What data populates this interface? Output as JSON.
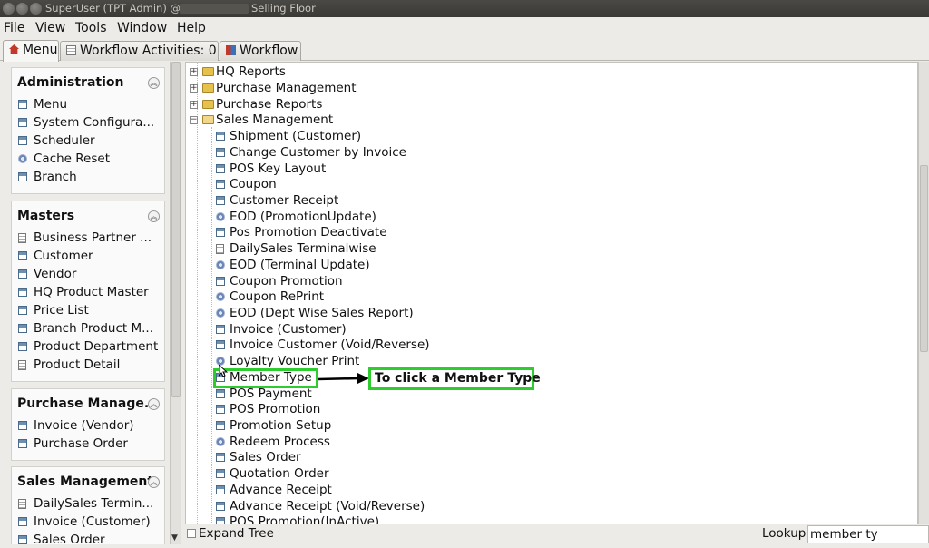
{
  "window": {
    "title_part1": "SuperUser (TPT Admin) @",
    "title_part2": "Selling Floor"
  },
  "menubar": [
    "File",
    "View",
    "Tools",
    "Window",
    "Help"
  ],
  "tabs": [
    {
      "label": "Menu",
      "icon": "home-icon"
    },
    {
      "label": "Workflow Activities: 0",
      "icon": "document-icon"
    },
    {
      "label": "Workflow",
      "icon": "workflow-icon"
    }
  ],
  "groups": [
    {
      "title": "Administration",
      "items": [
        {
          "label": "Menu",
          "icon": "window-icon"
        },
        {
          "label": "System Configura...",
          "icon": "window-icon"
        },
        {
          "label": "Scheduler",
          "icon": "window-icon"
        },
        {
          "label": "Cache Reset",
          "icon": "gear-icon"
        },
        {
          "label": "Branch",
          "icon": "window-icon"
        }
      ]
    },
    {
      "title": "Masters",
      "items": [
        {
          "label": "Business Partner ...",
          "icon": "document-icon"
        },
        {
          "label": "Customer",
          "icon": "window-icon"
        },
        {
          "label": "Vendor",
          "icon": "window-icon"
        },
        {
          "label": "HQ Product Master",
          "icon": "window-icon"
        },
        {
          "label": "Price List",
          "icon": "window-icon"
        },
        {
          "label": "Branch Product M...",
          "icon": "window-icon"
        },
        {
          "label": "Product Department",
          "icon": "window-icon"
        },
        {
          "label": "Product Detail",
          "icon": "document-icon"
        }
      ]
    },
    {
      "title": "Purchase Manage...",
      "items": [
        {
          "label": "Invoice (Vendor)",
          "icon": "window-icon"
        },
        {
          "label": "Purchase Order",
          "icon": "window-icon"
        }
      ]
    },
    {
      "title": "Sales Management",
      "items": [
        {
          "label": "DailySales Termin...",
          "icon": "document-icon"
        },
        {
          "label": "Invoice (Customer)",
          "icon": "window-icon"
        },
        {
          "label": "Sales Order",
          "icon": "window-icon"
        }
      ]
    }
  ],
  "tree": {
    "folders": [
      {
        "label": "HQ Reports",
        "expanded": false
      },
      {
        "label": "Purchase Management",
        "expanded": false
      },
      {
        "label": "Purchase Reports",
        "expanded": false
      },
      {
        "label": "Sales Management",
        "expanded": true
      }
    ],
    "children": [
      {
        "label": "Shipment (Customer)",
        "icon": "window-icon"
      },
      {
        "label": "Change Customer by Invoice",
        "icon": "window-icon"
      },
      {
        "label": "POS Key Layout",
        "icon": "window-icon"
      },
      {
        "label": "Coupon",
        "icon": "window-icon"
      },
      {
        "label": "Customer Receipt",
        "icon": "window-icon"
      },
      {
        "label": "EOD (PromotionUpdate)",
        "icon": "gear-icon"
      },
      {
        "label": "Pos Promotion Deactivate",
        "icon": "window-icon"
      },
      {
        "label": "DailySales Terminalwise",
        "icon": "document-icon"
      },
      {
        "label": "EOD (Terminal Update)",
        "icon": "gear-icon"
      },
      {
        "label": "Coupon Promotion",
        "icon": "window-icon"
      },
      {
        "label": "Coupon RePrint",
        "icon": "gear-icon"
      },
      {
        "label": "EOD (Dept Wise Sales Report)",
        "icon": "gear-icon"
      },
      {
        "label": "Invoice (Customer)",
        "icon": "window-icon"
      },
      {
        "label": "Invoice Customer (Void/Reverse)",
        "icon": "window-icon"
      },
      {
        "label": "Loyalty Voucher Print",
        "icon": "gear-icon"
      },
      {
        "label": "Member Type",
        "icon": "window-icon"
      },
      {
        "label": "POS Payment",
        "icon": "window-icon"
      },
      {
        "label": "POS Promotion",
        "icon": "window-icon"
      },
      {
        "label": "Promotion Setup",
        "icon": "window-icon"
      },
      {
        "label": "Redeem Process",
        "icon": "gear-icon"
      },
      {
        "label": "Sales Order",
        "icon": "window-icon"
      },
      {
        "label": "Quotation Order",
        "icon": "window-icon"
      },
      {
        "label": "Advance Receipt",
        "icon": "window-icon"
      },
      {
        "label": "Advance Receipt (Void/Reverse)",
        "icon": "window-icon"
      },
      {
        "label": "POS Promotion(InActive)",
        "icon": "window-icon"
      }
    ]
  },
  "bottom": {
    "expand_tree_label": "Expand Tree",
    "lookup_label": "Lookup",
    "lookup_value": "member ty"
  },
  "annotation": {
    "callout_text": "To click a Member Type",
    "highlight_color": "#2ecc2e"
  }
}
